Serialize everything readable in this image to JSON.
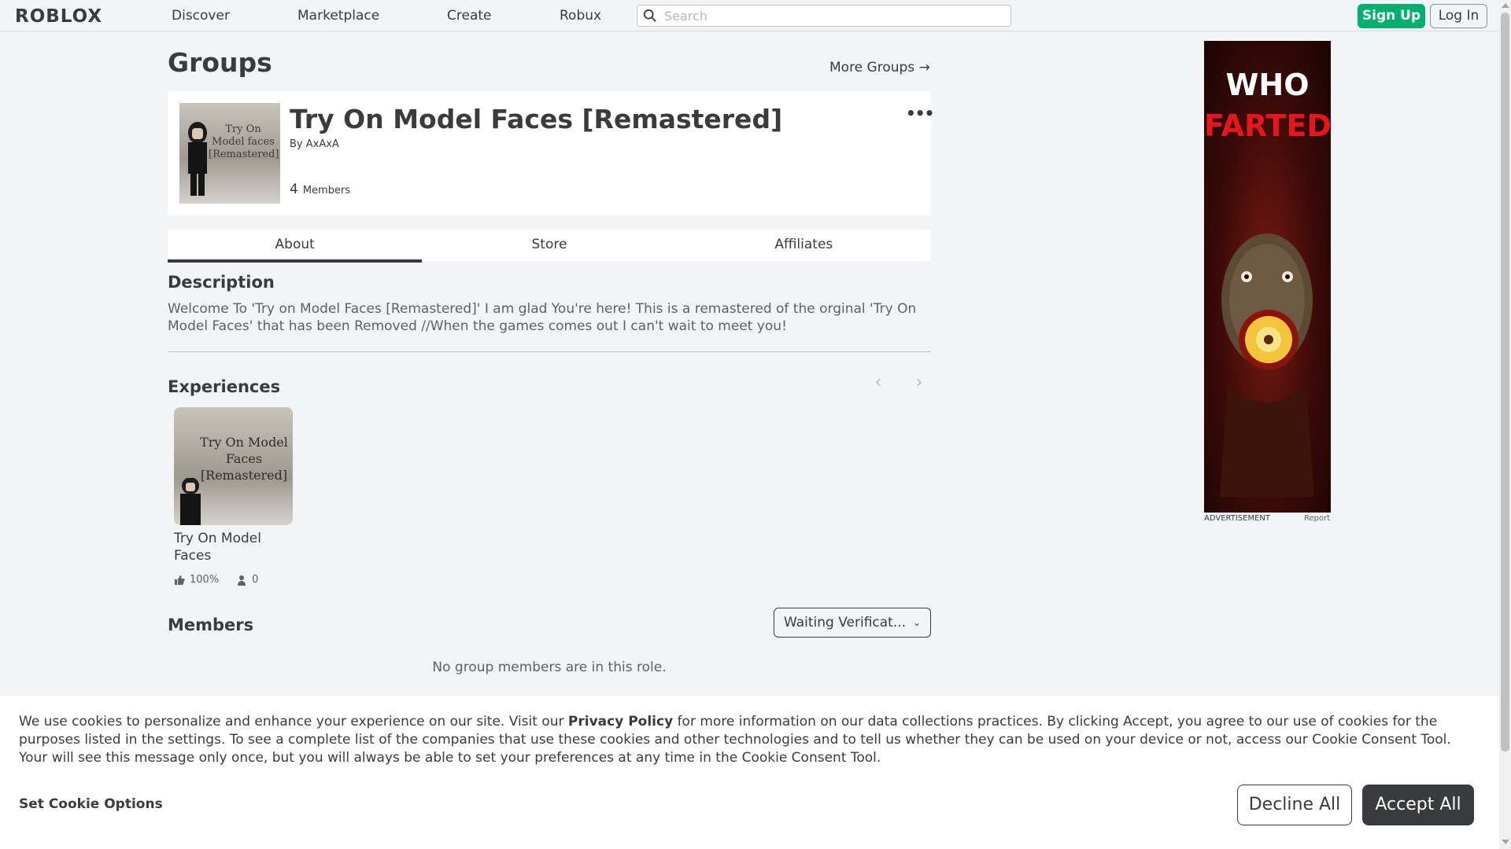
{
  "nav": {
    "logo": "ROBLOX",
    "links": [
      "Discover",
      "Marketplace",
      "Create",
      "Robux"
    ],
    "search_placeholder": "Search",
    "signup": "Sign Up",
    "login": "Log In"
  },
  "page": {
    "title": "Groups",
    "more_groups": "More Groups →"
  },
  "group": {
    "name": "Try On Model Faces [Remastered]",
    "by_prefix": "By",
    "owner": "AxAxA",
    "member_count": "4",
    "members_label": "Members",
    "thumb_caption": "Try On Model faces [Remastered]",
    "menu": "•••"
  },
  "tabs": [
    "About",
    "Store",
    "Affiliates"
  ],
  "description": {
    "heading": "Description",
    "text": "Welcome To 'Try on Model Faces [Remastered]' I am glad You're here! This is a remastered of the orginal 'Try On Model Faces' that has been Removed //When the games comes out I can't wait to meet you!"
  },
  "experiences": {
    "heading": "Experiences",
    "prev": "‹",
    "next": "›",
    "items": [
      {
        "name": "Try On Model Faces",
        "thumb_caption": "Try On Model Faces [Remastered]",
        "rating": "100%",
        "players": "0"
      }
    ]
  },
  "members": {
    "heading": "Members",
    "role_selected": "Waiting Verificat...",
    "empty": "No group members are in this role."
  },
  "ad": {
    "line1": "WHO",
    "line2": "FARTED",
    "label": "ADVERTISEMENT",
    "report": "Report"
  },
  "cookie": {
    "text_before": "We use cookies to personalize and enhance your experience on our site. Visit our ",
    "link": "Privacy Policy",
    "text_after": " for more information on our data collections practices. By clicking Accept, you agree to our use of cookies for the purposes listed in the settings. To see a complete list of the companies that use these cookies and other technologies and to tell us whether they can be used on your device or not, access our Cookie Consent Tool. Your will see this message only once, but you will always be able to set your preferences at any time in the Cookie Consent Tool.",
    "options": "Set Cookie Options",
    "decline": "Decline All",
    "accept": "Accept All"
  },
  "colors": {
    "accent_green": "#00b06f",
    "text_dark": "#393b3d",
    "ad_red": "#e8151b"
  }
}
